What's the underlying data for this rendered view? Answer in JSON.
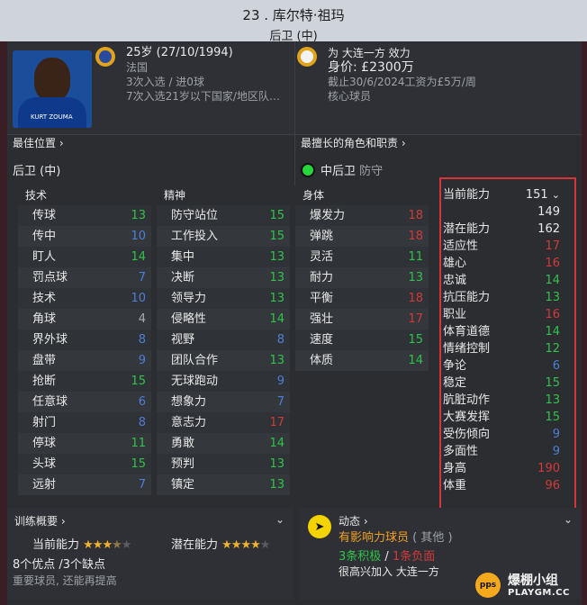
{
  "header": {
    "title": "23 . 库尔特·祖玛",
    "position": "后卫 (中)"
  },
  "player": {
    "age_birth": "25岁 (27/10/1994)",
    "nation": "法国",
    "caps": "3次入选 / 进0球",
    "u21": "7次入选21岁以下国家/地区队…",
    "kit_text": "KURT ZOUMA"
  },
  "contract": {
    "club_line": "为 大连一方 效力",
    "value": "身价: £2300万",
    "expiry": "截止30/6/2024工资为£5万/周",
    "status": "核心球员"
  },
  "best_position": {
    "label": "最佳位置",
    "value": "后卫 (中)"
  },
  "best_role": {
    "label": "最擅长的角色和职责",
    "role": "中后卫",
    "duty": "防守"
  },
  "attributes": {
    "technical": {
      "title": "技术",
      "rows": [
        {
          "name": "传球",
          "value": "13",
          "c": "green"
        },
        {
          "name": "传中",
          "value": "10",
          "c": "blue"
        },
        {
          "name": "盯人",
          "value": "14",
          "c": "green"
        },
        {
          "name": "罚点球",
          "value": "7",
          "c": "blue"
        },
        {
          "name": "技术",
          "value": "10",
          "c": "blue"
        },
        {
          "name": "角球",
          "value": "4",
          "c": "gray"
        },
        {
          "name": "界外球",
          "value": "8",
          "c": "blue"
        },
        {
          "name": "盘带",
          "value": "9",
          "c": "blue"
        },
        {
          "name": "抢断",
          "value": "15",
          "c": "green"
        },
        {
          "name": "任意球",
          "value": "6",
          "c": "blue"
        },
        {
          "name": "射门",
          "value": "8",
          "c": "blue"
        },
        {
          "name": "停球",
          "value": "11",
          "c": "green"
        },
        {
          "name": "头球",
          "value": "15",
          "c": "green"
        },
        {
          "name": "远射",
          "value": "7",
          "c": "blue"
        }
      ]
    },
    "mental": {
      "title": "精神",
      "rows": [
        {
          "name": "防守站位",
          "value": "15",
          "c": "green"
        },
        {
          "name": "工作投入",
          "value": "15",
          "c": "green"
        },
        {
          "name": "集中",
          "value": "13",
          "c": "green"
        },
        {
          "name": "决断",
          "value": "13",
          "c": "green"
        },
        {
          "name": "领导力",
          "value": "13",
          "c": "green"
        },
        {
          "name": "侵略性",
          "value": "14",
          "c": "green"
        },
        {
          "name": "视野",
          "value": "8",
          "c": "blue"
        },
        {
          "name": "团队合作",
          "value": "13",
          "c": "green"
        },
        {
          "name": "无球跑动",
          "value": "9",
          "c": "blue"
        },
        {
          "name": "想象力",
          "value": "7",
          "c": "blue"
        },
        {
          "name": "意志力",
          "value": "17",
          "c": "red"
        },
        {
          "name": "勇敢",
          "value": "14",
          "c": "green"
        },
        {
          "name": "预判",
          "value": "13",
          "c": "green"
        },
        {
          "name": "镇定",
          "value": "13",
          "c": "green"
        }
      ]
    },
    "physical": {
      "title": "身体",
      "rows": [
        {
          "name": "爆发力",
          "value": "18",
          "c": "red"
        },
        {
          "name": "弹跳",
          "value": "18",
          "c": "red"
        },
        {
          "name": "灵活",
          "value": "11",
          "c": "green"
        },
        {
          "name": "耐力",
          "value": "13",
          "c": "green"
        },
        {
          "name": "平衡",
          "value": "18",
          "c": "red"
        },
        {
          "name": "强壮",
          "value": "17",
          "c": "red"
        },
        {
          "name": "速度",
          "value": "15",
          "c": "green"
        },
        {
          "name": "体质",
          "value": "14",
          "c": "green"
        }
      ]
    }
  },
  "hidden": {
    "ability_label": "当前能力",
    "ability": "151",
    "ability2": "149",
    "potential_label": "潜在能力",
    "potential": "162",
    "rows": [
      {
        "name": "适应性",
        "value": "17",
        "c": "red"
      },
      {
        "name": "雄心",
        "value": "16",
        "c": "red"
      },
      {
        "name": "忠诚",
        "value": "14",
        "c": "green"
      },
      {
        "name": "抗压能力",
        "value": "13",
        "c": "green"
      },
      {
        "name": "职业",
        "value": "16",
        "c": "red"
      },
      {
        "name": "体育道德",
        "value": "14",
        "c": "green"
      },
      {
        "name": "情绪控制",
        "value": "12",
        "c": "green"
      },
      {
        "name": "争论",
        "value": "6",
        "c": "blue"
      },
      {
        "name": "稳定",
        "value": "15",
        "c": "green"
      },
      {
        "name": "肮脏动作",
        "value": "13",
        "c": "green"
      },
      {
        "name": "大赛发挥",
        "value": "15",
        "c": "green"
      },
      {
        "name": "受伤倾向",
        "value": "9",
        "c": "blue"
      },
      {
        "name": "多面性",
        "value": "9",
        "c": "blue"
      },
      {
        "name": "身高",
        "value": "190",
        "c": "red"
      },
      {
        "name": "体重",
        "value": "96",
        "c": "red"
      }
    ]
  },
  "training": {
    "title": "训练概要",
    "current_label": "当前能力",
    "current_stars": 3.5,
    "potential_label": "潜在能力",
    "potential_stars": 4,
    "summary": "8个优点 /3个缺点",
    "note": "重要球员, 还能再提高"
  },
  "dynamics": {
    "title": "动态",
    "influence": "有影响力球员",
    "influence_sub": "( 其他 )",
    "positive": "3条积极",
    "sep": "/",
    "negative": "1条负面",
    "joined": "很高兴加入 大连一方"
  },
  "watermark": {
    "cn": "爆棚小组",
    "en": "PLAYGM.CC",
    "badge": "pps"
  },
  "colors": {
    "green": "#2fc34a",
    "blue": "#4d7fd6",
    "red": "#d23a3a",
    "gray": "#aaaaaa",
    "highlight_box": "#d8323a"
  }
}
